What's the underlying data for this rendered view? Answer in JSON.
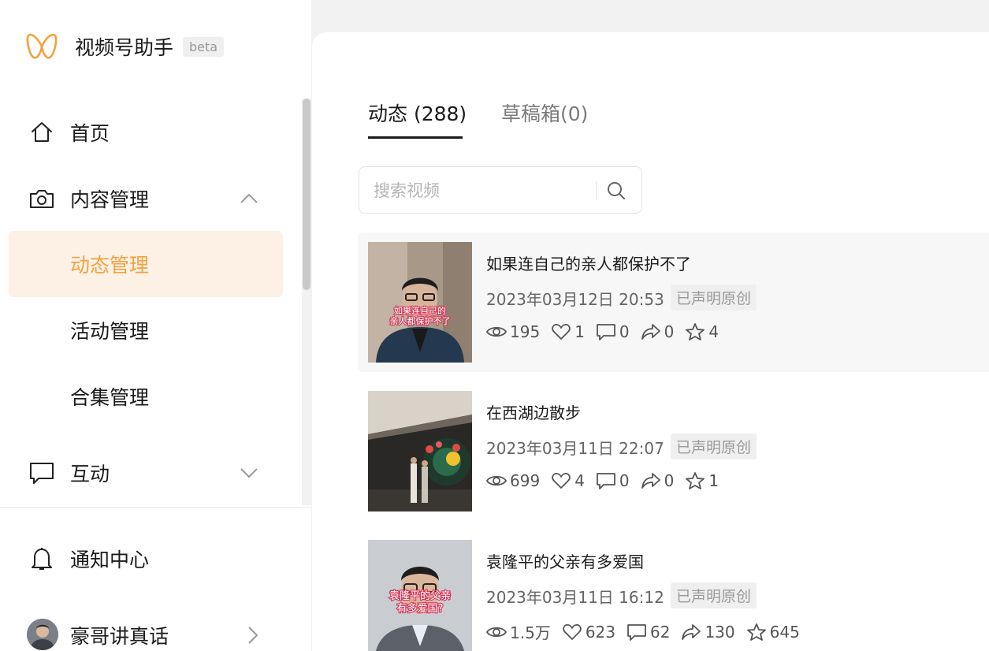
{
  "app": {
    "title": "视频号助手",
    "badge": "beta"
  },
  "sidebar": {
    "home": "首页",
    "content": "内容管理",
    "sub_items": [
      "动态管理",
      "活动管理",
      "合集管理"
    ],
    "interact": "互动",
    "notify": "通知中心",
    "user": "豪哥讲真话"
  },
  "tabs": [
    "动态 (288)",
    "草稿箱(0)"
  ],
  "search": {
    "placeholder": "搜索视频"
  },
  "posts": [
    {
      "title": "如果连自己的亲人都保护不了",
      "date": "2023年03月12日 20:53",
      "badge": "已声明原创",
      "views": "195",
      "likes": "1",
      "comments": "0",
      "shares": "0",
      "favorites": "4",
      "caption": [
        "如果连自己的",
        "亲人都保护不了"
      ]
    },
    {
      "title": "在西湖边散步",
      "date": "2023年03月11日 22:07",
      "badge": "已声明原创",
      "views": "699",
      "likes": "4",
      "comments": "0",
      "shares": "0",
      "favorites": "1"
    },
    {
      "title": "袁隆平的父亲有多爱国",
      "date": "2023年03月11日 16:12",
      "badge": "已声明原创",
      "views": "1.5万",
      "likes": "623",
      "comments": "62",
      "shares": "130",
      "favorites": "645",
      "caption": [
        "袁隆平的父亲",
        "有多爱国?"
      ]
    }
  ],
  "colors": {
    "accent": "#f5a13e",
    "active_bg": "#fdf1e6"
  }
}
